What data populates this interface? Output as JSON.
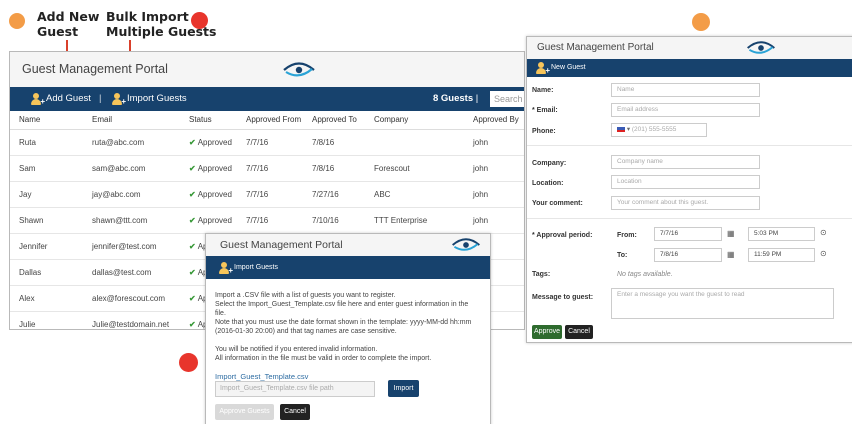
{
  "callouts": {
    "add_new": "Add New\nGuest",
    "add_new_line1": "Add New",
    "add_new_line2": "Guest",
    "bulk_line1": "Bulk Import –",
    "bulk_line2": "Multiple Guests"
  },
  "colors": {
    "brand_bar": "#17426d",
    "approve_green": "#3a9a3a",
    "callout_orange": "#f39c47",
    "callout_red": "#e8352c"
  },
  "main": {
    "title": "Guest Management Portal",
    "add_guest": "Add Guest",
    "separator": "|",
    "import_guests": "Import Guests",
    "guest_count": "8 Guests",
    "count_separator": "|",
    "search_placeholder": "Search for",
    "columns": [
      "Name",
      "Email",
      "Status",
      "Approved From",
      "Approved To",
      "Company",
      "Approved By"
    ],
    "rows": [
      {
        "name": "Ruta",
        "email": "ruta@abc.com",
        "status": "Approved",
        "from": "7/7/16",
        "to": "7/8/16",
        "company": "",
        "by": "john"
      },
      {
        "name": "Sam",
        "email": "sam@abc.com",
        "status": "Approved",
        "from": "7/7/16",
        "to": "7/8/16",
        "company": "Forescout",
        "by": "john"
      },
      {
        "name": "Jay",
        "email": "jay@abc.com",
        "status": "Approved",
        "from": "7/7/16",
        "to": "7/27/16",
        "company": "ABC",
        "by": "john"
      },
      {
        "name": "Shawn",
        "email": "shawn@ttt.com",
        "status": "Approved",
        "from": "7/7/16",
        "to": "7/10/16",
        "company": "TTT Enterprise",
        "by": "john"
      },
      {
        "name": "Jennifer",
        "email": "jennifer@test.com",
        "status": "App",
        "from": "",
        "to": "",
        "company": "",
        "by": ""
      },
      {
        "name": "Dallas",
        "email": "dallas@test.com",
        "status": "App",
        "from": "",
        "to": "",
        "company": "",
        "by": ""
      },
      {
        "name": "Alex",
        "email": "alex@forescout.com",
        "status": "App",
        "from": "",
        "to": "",
        "company": "",
        "by": ""
      },
      {
        "name": "Julie",
        "email": "Julie@testdomain.net",
        "status": "App",
        "from": "",
        "to": "",
        "company": "",
        "by": ""
      }
    ]
  },
  "import": {
    "title": "Guest Management Portal",
    "header": "Import Guests",
    "line1": "Import a .CSV file with a list of guests you want to register.",
    "line2": "Select the Import_Guest_Template.csv file here and enter guest information in the file.",
    "line3": "Note that you must use the date format shown in the template: yyyy-MM-dd hh:mm",
    "line4": "(2016-01-30 20:00) and that tag names are case sensitive.",
    "line5": "You will be notified if you entered invalid information.",
    "line6": "All information in the file must be valid in order to complete the import.",
    "template_link": "Import_Guest_Template.csv",
    "file_placeholder": "Import_Guest_Template.csv file path",
    "import_button": "Import",
    "approve_button": "Approve Guests",
    "cancel_button": "Cancel"
  },
  "new_guest": {
    "title": "Guest Management Portal",
    "header": "New Guest",
    "name_label": "Name:",
    "name_placeholder": "Name",
    "email_label": "* Email:",
    "email_placeholder": "Email address",
    "phone_label": "Phone:",
    "phone_placeholder": "(201) 555-5555",
    "company_label": "Company:",
    "company_placeholder": "Company name",
    "location_label": "Location:",
    "location_placeholder": "Location",
    "comment_label": "Your comment:",
    "comment_placeholder": "Your comment about this guest.",
    "approval_label": "* Approval period:",
    "from_label": "From:",
    "from_date": "7/7/16",
    "from_time": "5:03 PM",
    "to_label": "To:",
    "to_date": "7/8/16",
    "to_time": "11:59 PM",
    "tags_label": "Tags:",
    "tags_value": "No tags available.",
    "message_label": "Message to guest:",
    "message_placeholder": "Enter a message you want the guest to read",
    "approve_button": "Approve",
    "cancel_button": "Cancel"
  }
}
